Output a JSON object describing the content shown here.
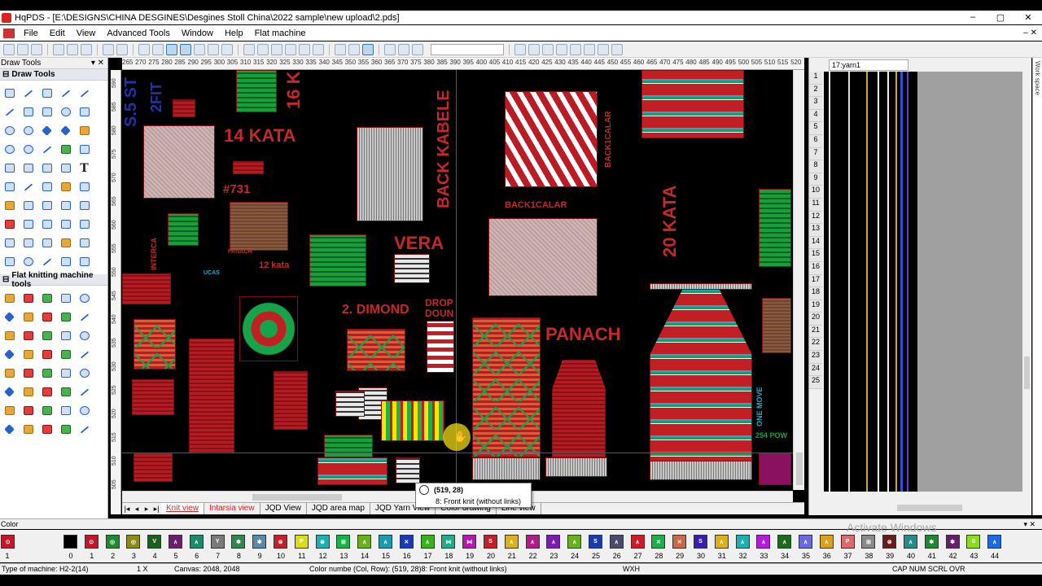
{
  "app": {
    "title": "HqPDS - [E:\\DESIGNS\\CHINA DESGINES\\Desgines Stoll China\\2022 sample\\new upload\\2.pds]",
    "window_buttons": [
      "–",
      "▢",
      "✕"
    ]
  },
  "menu": {
    "items": [
      "File",
      "Edit",
      "View",
      "Advanced Tools",
      "Window",
      "Help",
      "Flat machine"
    ],
    "right_buttons": "– ✕"
  },
  "left_panel": {
    "title": "Draw Tools",
    "pin": "▾ ✕",
    "group_draw": "Draw Tools",
    "group_flat": "Flat knitting machine tools"
  },
  "ruler": {
    "h_ticks": [
      "265",
      "270",
      "275",
      "280",
      "285",
      "290",
      "295",
      "300",
      "305",
      "310",
      "315",
      "320",
      "325",
      "330",
      "335",
      "340",
      "345",
      "350",
      "355",
      "360",
      "365",
      "370",
      "375",
      "380",
      "385",
      "390",
      "395",
      "400",
      "405",
      "410",
      "415",
      "420",
      "425",
      "430",
      "435",
      "440",
      "445",
      "450",
      "455",
      "460",
      "465",
      "470",
      "475",
      "480",
      "485",
      "490",
      "495",
      "500",
      "505",
      "510",
      "515",
      "520"
    ],
    "v_ticks": [
      "590",
      "585",
      "580",
      "575",
      "570",
      "565",
      "560",
      "555",
      "550",
      "545",
      "540",
      "535",
      "530",
      "525",
      "520",
      "515",
      "510",
      "505"
    ]
  },
  "canvas_labels": {
    "s_5_st": "S.5 ST",
    "two_fit": "2FIT",
    "sixteen_ka": "16 K",
    "fourteen_kata": "14 KATA",
    "num_731": "#731",
    "back_kabele": "BACK KABELE",
    "back1calar_v": "BACK1CALAR",
    "back1calar_h": "BACK1CALAR",
    "twenty_kata": "20 KATA",
    "vera": "VERA",
    "twelve_kata": "12 kata",
    "drop_down": "DROP DOUN",
    "two_dimond": "2. DIMOND",
    "panach": "PANACH",
    "one_move": "ONE MOVE",
    "pow": "254 POW",
    "ucas": "UCAS",
    "panach_small": "PANACH",
    "interca": "INTERCA"
  },
  "tabs": {
    "nav": [
      "|◂",
      "◂",
      "▸",
      "▸|"
    ],
    "items": [
      "Knit view",
      "Intarsia view",
      "JQD View",
      "JQD area map",
      "JQD Yarn View",
      "Color drawing",
      "Line view"
    ]
  },
  "tooltip": {
    "coords": "(519, 28)",
    "desc": "8: Front knit (without links)"
  },
  "right_pane": {
    "yarn_select": "17:yarn1",
    "rows": [
      "1",
      "2",
      "3",
      "4",
      "5",
      "6",
      "7",
      "8",
      "9",
      "10",
      "11",
      "12",
      "13",
      "14",
      "15",
      "16",
      "17",
      "18",
      "19",
      "20",
      "21",
      "22",
      "23",
      "24",
      "25"
    ],
    "side_label": "Work space"
  },
  "color_panel": {
    "title": "Color",
    "header_buttons": "▾ ✕",
    "current_number": "1",
    "swatches": [
      {
        "n": "0",
        "c": "#000000",
        "g": ""
      },
      {
        "n": "1",
        "c": "#c0192b",
        "g": "⊙"
      },
      {
        "n": "2",
        "c": "#1c8a2e",
        "g": "◎"
      },
      {
        "n": "3",
        "c": "#8b8b1c",
        "g": "◎"
      },
      {
        "n": "4",
        "c": "#1d5f1d",
        "g": "V"
      },
      {
        "n": "5",
        "c": "#6a1f6a",
        "g": "∧"
      },
      {
        "n": "6",
        "c": "#1c8a6a",
        "g": "∧"
      },
      {
        "n": "7",
        "c": "#7a7a7a",
        "g": "Y"
      },
      {
        "n": "8",
        "c": "#2e8a4a",
        "g": "✱"
      },
      {
        "n": "9",
        "c": "#5a8aaa",
        "g": "✱"
      },
      {
        "n": "10",
        "c": "#c81e2a",
        "g": "⊗"
      },
      {
        "n": "11",
        "c": "#dcdc14",
        "g": "P"
      },
      {
        "n": "12",
        "c": "#1cb0b0",
        "g": "⊗"
      },
      {
        "n": "13",
        "c": "#1ab04a",
        "g": "⊞"
      },
      {
        "n": "14",
        "c": "#6ab01c",
        "g": "∧"
      },
      {
        "n": "15",
        "c": "#1c9ab0",
        "g": "∧"
      },
      {
        "n": "16",
        "c": "#1c3ab0",
        "g": "✕"
      },
      {
        "n": "17",
        "c": "#3ab01c",
        "g": "∧"
      },
      {
        "n": "18",
        "c": "#1cb08a",
        "g": "⋈"
      },
      {
        "n": "19",
        "c": "#b01cb0",
        "g": "⋈"
      },
      {
        "n": "20",
        "c": "#c81e2a",
        "g": "S"
      },
      {
        "n": "21",
        "c": "#dcb01c",
        "g": "∧"
      },
      {
        "n": "22",
        "c": "#b01c8a",
        "g": "∧"
      },
      {
        "n": "23",
        "c": "#7a1cb0",
        "g": "∧"
      },
      {
        "n": "24",
        "c": "#6ab01c",
        "g": "∧"
      },
      {
        "n": "25",
        "c": "#1c3ab0",
        "g": "S"
      },
      {
        "n": "26",
        "c": "#4a4a6a",
        "g": "∧"
      },
      {
        "n": "27",
        "c": "#c81e2a",
        "g": "∧"
      },
      {
        "n": "28",
        "c": "#1cb04a",
        "g": "✕"
      },
      {
        "n": "29",
        "c": "#c86a4a",
        "g": "✕"
      },
      {
        "n": "30",
        "c": "#3a1cb0",
        "g": "S"
      },
      {
        "n": "31",
        "c": "#dcb01c",
        "g": "∧"
      },
      {
        "n": "32",
        "c": "#1cb0b0",
        "g": "∧"
      },
      {
        "n": "33",
        "c": "#b01cdc",
        "g": "∧"
      },
      {
        "n": "34",
        "c": "#1c6a1c",
        "g": "∧"
      },
      {
        "n": "35",
        "c": "#6a6adc",
        "g": "∧"
      },
      {
        "n": "36",
        "c": "#dca01c",
        "g": "∧"
      },
      {
        "n": "37",
        "c": "#dc6a6a",
        "g": "P"
      },
      {
        "n": "38",
        "c": "#8a8a8a",
        "g": "⊞"
      },
      {
        "n": "39",
        "c": "#6a1c1c",
        "g": "⊗"
      },
      {
        "n": "40",
        "c": "#2a8a8a",
        "g": "∧"
      },
      {
        "n": "41",
        "c": "#1c8a2e",
        "g": "✱"
      },
      {
        "n": "42",
        "c": "#6a1c6a",
        "g": "✱"
      },
      {
        "n": "43",
        "c": "#8adc1c",
        "g": "S"
      },
      {
        "n": "44",
        "c": "#1c6adc",
        "g": "∧"
      }
    ]
  },
  "watermark": "Activate Windows",
  "status": {
    "machine": "Type of machine: H2-2(14)",
    "zoom": "1 X",
    "canvas": "Canvas: 2048, 2048",
    "color_info": "Color numbe (Col, Row): (519, 28)8: Front knit (without links)",
    "wxh": "WXH",
    "keys": "CAP  NUM  SCRL  OVR"
  }
}
